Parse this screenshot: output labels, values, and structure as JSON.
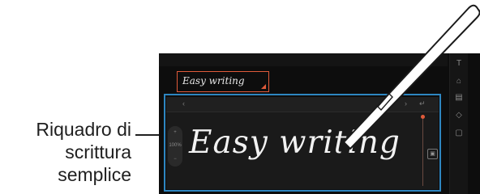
{
  "callout": {
    "lines": [
      "Riquadro di",
      "scrittura",
      "semplice"
    ]
  },
  "text_field": {
    "value": "Easy writing"
  },
  "handwriting_panel": {
    "written_text": "Easy writing",
    "zoom_label": "100%",
    "toolbar": {
      "left_glyph": "‹",
      "next_glyph": "›",
      "enter_glyph": "↵"
    }
  },
  "side_toolbar": {
    "icons": [
      "text-icon",
      "highlighter-icon",
      "insert-text-icon",
      "eraser-icon",
      "convert-icon"
    ]
  },
  "colors": {
    "accent": "#e05a3a",
    "frame": "#2e86c1",
    "panel": "#1a1a1a"
  }
}
